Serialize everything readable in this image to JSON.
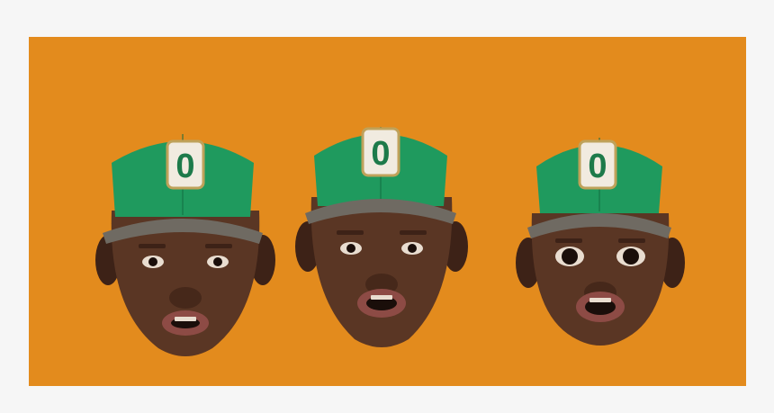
{
  "colors": {
    "page_background": "#f6f6f6",
    "panel_background": "#e38b1d",
    "cap_green": "#1f9a5e",
    "cap_green_dark": "#136b40",
    "cap_brim": "#6f6a62",
    "badge_fill": "#f1ebe0",
    "badge_border": "#bfa25a",
    "badge_letter": "#1d7a4a",
    "skin": "#5a3624",
    "skin_shadow": "#3d2217",
    "lips": "#8d4b45",
    "eye_white": "#e9ddd0",
    "eye_pupil": "#1a0e0a"
  },
  "heads": [
    {
      "expression": "neutral",
      "badge_letter": "0"
    },
    {
      "expression": "speaking",
      "badge_letter": "0"
    },
    {
      "expression": "surprised",
      "badge_letter": "0"
    }
  ]
}
